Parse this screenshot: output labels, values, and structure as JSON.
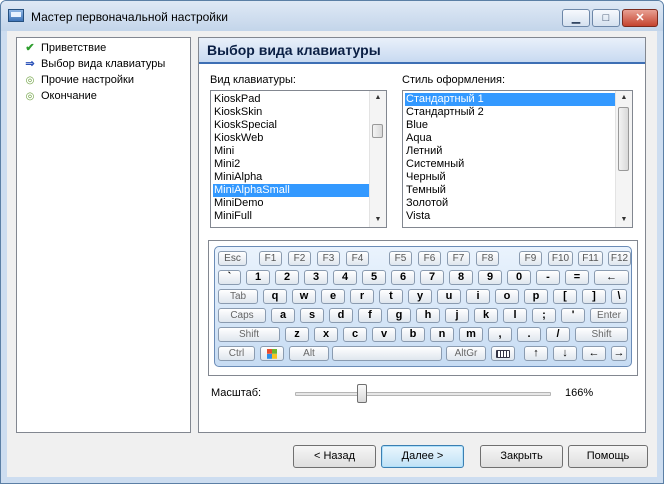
{
  "window": {
    "title": "Мастер первоначальной настройки"
  },
  "nav": {
    "items": [
      {
        "label": "Приветствие",
        "icon": "check-icon"
      },
      {
        "label": "Выбор вида клавиатуры",
        "icon": "arrow-right-icon"
      },
      {
        "label": "Прочие настройки",
        "icon": "bullet-icon"
      },
      {
        "label": "Окончание",
        "icon": "bullet-icon"
      }
    ]
  },
  "header": {
    "title": "Выбор вида клавиатуры"
  },
  "keyboard_type": {
    "label": "Вид клавиатуры:",
    "items": [
      "KioskPad",
      "KioskSkin",
      "KioskSpecial",
      "KioskWeb",
      "Mini",
      "Mini2",
      "MiniAlpha",
      "MiniAlphaSmall",
      "MiniDemo",
      "MiniFull"
    ],
    "selected": "MiniAlphaSmall"
  },
  "style": {
    "label": "Стиль оформления:",
    "items": [
      "Стандартный 1",
      "Стандартный 2",
      "Blue",
      "Aqua",
      "Летний",
      "Системный",
      "Черный",
      "Темный",
      "Золотой",
      "Vista"
    ],
    "selected": "Стандартный 1"
  },
  "preview": {
    "rows": [
      [
        "Esc",
        "F1",
        "F2",
        "F3",
        "F4",
        "F5",
        "F6",
        "F7",
        "F8",
        "F9",
        "F10",
        "F11",
        "F12"
      ],
      [
        "`",
        "1",
        "2",
        "3",
        "4",
        "5",
        "6",
        "7",
        "8",
        "9",
        "0",
        "-",
        "=",
        "←"
      ],
      [
        "Tab",
        "q",
        "w",
        "e",
        "r",
        "t",
        "y",
        "u",
        "i",
        "o",
        "p",
        "[",
        "]",
        "\\"
      ],
      [
        "Caps",
        "a",
        "s",
        "d",
        "f",
        "g",
        "h",
        "j",
        "k",
        "l",
        ";",
        "'",
        "Enter"
      ],
      [
        "Shift",
        "z",
        "x",
        "c",
        "v",
        "b",
        "n",
        "m",
        ",",
        ".",
        "/",
        "Shift"
      ],
      [
        "Ctrl",
        "",
        "Alt",
        "",
        "AltGr",
        "",
        "↑",
        "↓",
        "←",
        "→"
      ]
    ]
  },
  "scale": {
    "label": "Масштаб:",
    "value_text": "166%",
    "level": 0.25
  },
  "buttons": {
    "back": "< Назад",
    "next": "Далее >",
    "close": "Закрыть",
    "help": "Помощь"
  },
  "colors": {
    "selection": "#3399ff",
    "header_rule": "#3e6fb4",
    "check": "#2e9e2e",
    "arrow": "#2950b8"
  }
}
